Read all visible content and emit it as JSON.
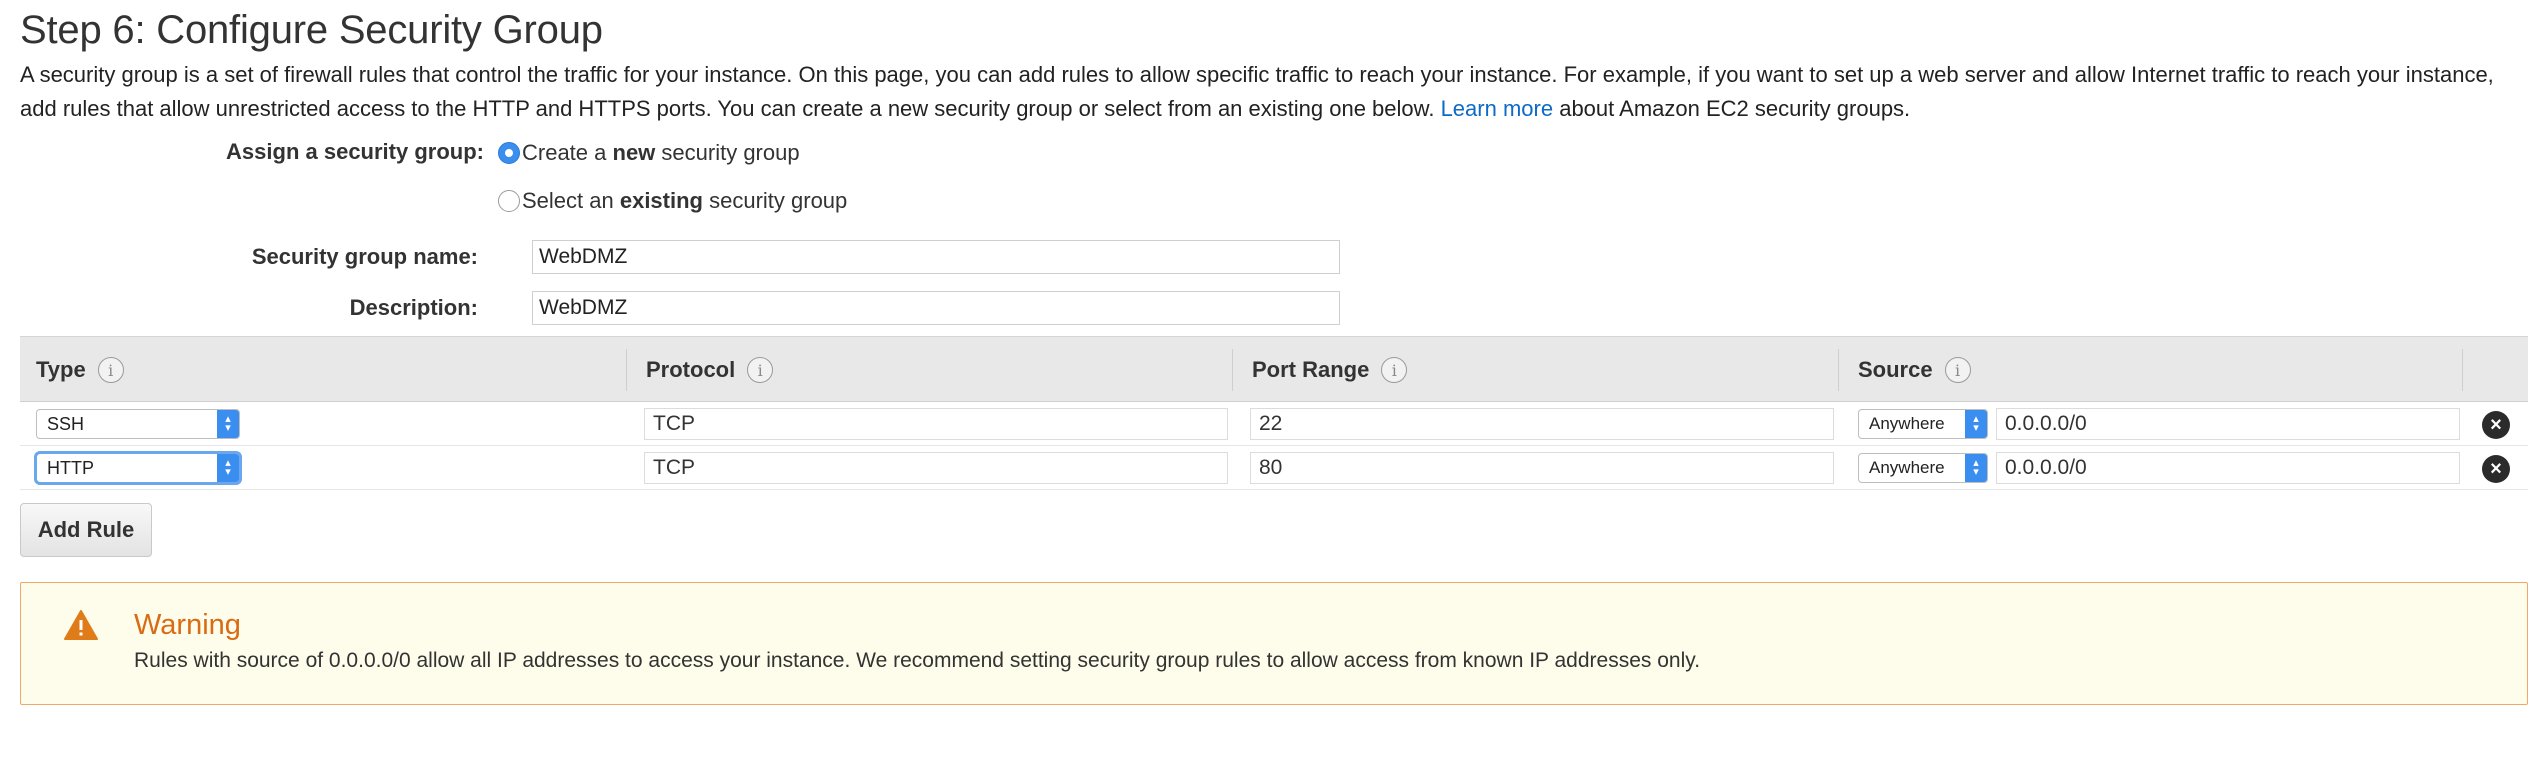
{
  "page": {
    "title": "Step 6: Configure Security Group",
    "intro_text": "A security group is a set of firewall rules that control the traffic for your instance. On this page, you can add rules to allow specific traffic to reach your instance. For example, if you want to set up a web server and allow Internet traffic to reach your instance, add rules that allow unrestricted access to the HTTP and HTTPS ports. You can create a new security group or select from an existing one below.",
    "learn_more_link": "Learn more",
    "intro_suffix": "about Amazon EC2 security groups."
  },
  "assign": {
    "label": "Assign a security group:",
    "options": [
      {
        "prefix": "Create a ",
        "bold": "new",
        "suffix": " security group",
        "checked": true
      },
      {
        "prefix": "Select an ",
        "bold": "existing",
        "suffix": " security group",
        "checked": false
      }
    ]
  },
  "group_name": {
    "label": "Security group name:",
    "value": "WebDMZ"
  },
  "description": {
    "label": "Description:",
    "value": "WebDMZ"
  },
  "rules_table": {
    "columns": [
      "Type",
      "Protocol",
      "Port Range",
      "Source"
    ],
    "rows": [
      {
        "type": "SSH",
        "protocol": "TCP",
        "port_range": "22",
        "source_type": "Anywhere",
        "source_cidr": "0.0.0.0/0"
      },
      {
        "type": "HTTP",
        "protocol": "TCP",
        "port_range": "80",
        "source_type": "Anywhere",
        "source_cidr": "0.0.0.0/0"
      }
    ]
  },
  "add_rule_label": "Add Rule",
  "warning": {
    "title": "Warning",
    "text": "Rules with source of 0.0.0.0/0 allow all IP addresses to access your instance. We recommend setting security group rules to allow access from known IP addresses only."
  },
  "colors": {
    "link": "#0e6ac7",
    "radio_selected": "#3a8ef0",
    "warning_title": "#d96b14",
    "warning_border": "#f0a868",
    "warning_background": "#fefcea",
    "table_header_background": "#e8e8e8"
  },
  "icons": {
    "info": "info-icon",
    "select_arrows": "updown-arrows-icon",
    "remove": "remove-circle-icon",
    "warning": "warning-triangle-icon"
  }
}
